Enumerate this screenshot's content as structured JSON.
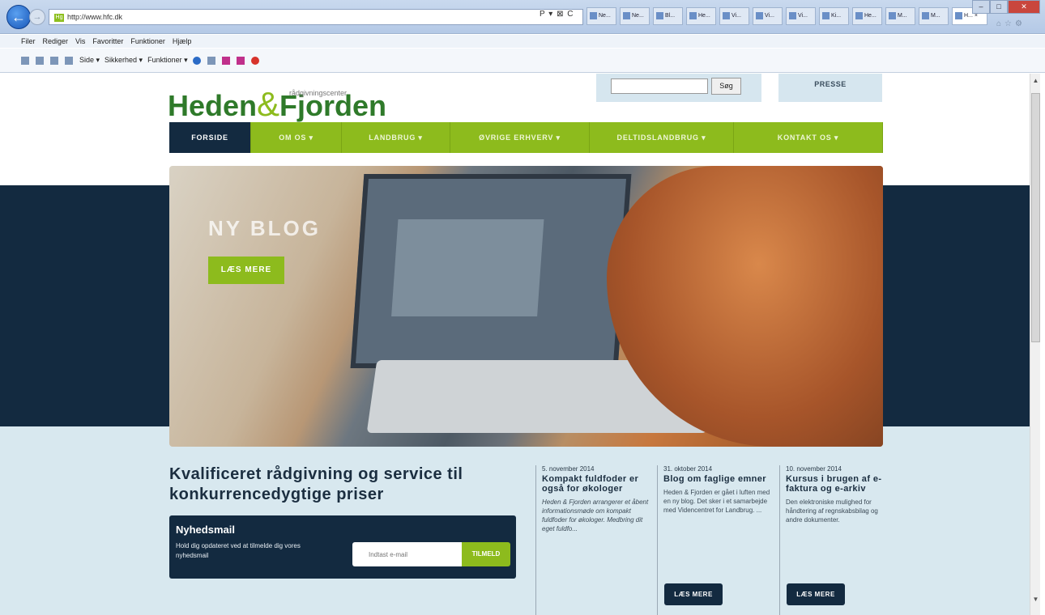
{
  "browser": {
    "url": "http://www.hfc.dk",
    "address_tools": "P ▾ ⊠ C",
    "tabs": [
      "Ne...",
      "Ne...",
      "Bl...",
      "He...",
      "Vi...",
      "Vi...",
      "Vi...",
      "Ki...",
      "He...",
      "M...",
      "M..."
    ],
    "active_tab": "H... ×",
    "menu": [
      "Filer",
      "Rediger",
      "Vis",
      "Favoritter",
      "Funktioner",
      "Hjælp"
    ],
    "toolbar": [
      "Side ▾",
      "Sikkerhed ▾",
      "Funktioner ▾"
    ]
  },
  "site": {
    "logo": {
      "part1": "Heden",
      "amp": "&",
      "part2": "Fjorden",
      "tagline": "rådgivningscenter"
    },
    "search_button": "Søg",
    "presse": "PRESSE",
    "nav": [
      {
        "label": "FORSIDE",
        "active": true
      },
      {
        "label": "OM OS  ▾"
      },
      {
        "label": "LANDBRUG  ▾"
      },
      {
        "label": "ØVRIGE ERHVERV  ▾"
      },
      {
        "label": "DELTIDSLANDBRUG  ▾"
      },
      {
        "label": "KONTAKT OS  ▾"
      }
    ],
    "hero": {
      "title": "NY BLOG",
      "button": "LÆS MERE"
    },
    "headline": "Kvalificeret rådgivning og service til konkurrencedygtige priser",
    "newsletter": {
      "title": "Nyhedsmail",
      "text": "Hold dig opdateret ved at tilmelde dig vores nyhedsmail",
      "placeholder": "Indtast e-mail",
      "button": "TILMELD"
    },
    "news": [
      {
        "date": "5. november 2014",
        "title": "Kompakt fuldfoder er også for økologer",
        "text": "Heden & Fjorden arrangerer et åbent informationsmøde om kompakt fuldfoder for økologer. Medbring dit eget fuldfo..."
      },
      {
        "date": "31. oktober 2014",
        "title": "Blog om faglige emner",
        "text": "Heden & Fjorden er gået i luften med en ny blog. Det sker i et samarbejde med Videncentret for Landbrug. ...",
        "button": "LÆS MERE"
      },
      {
        "date": "10. november 2014",
        "title": "Kursus i brugen af e-faktura og e-arkiv",
        "text": "Den elektroniske mulighed for håndtering af regnskabsbilag og andre dokumenter.",
        "button": "LÆS MERE"
      }
    ]
  },
  "colors": {
    "green": "#8dbb1d",
    "navy": "#132a40",
    "light": "#d8e8ef"
  }
}
